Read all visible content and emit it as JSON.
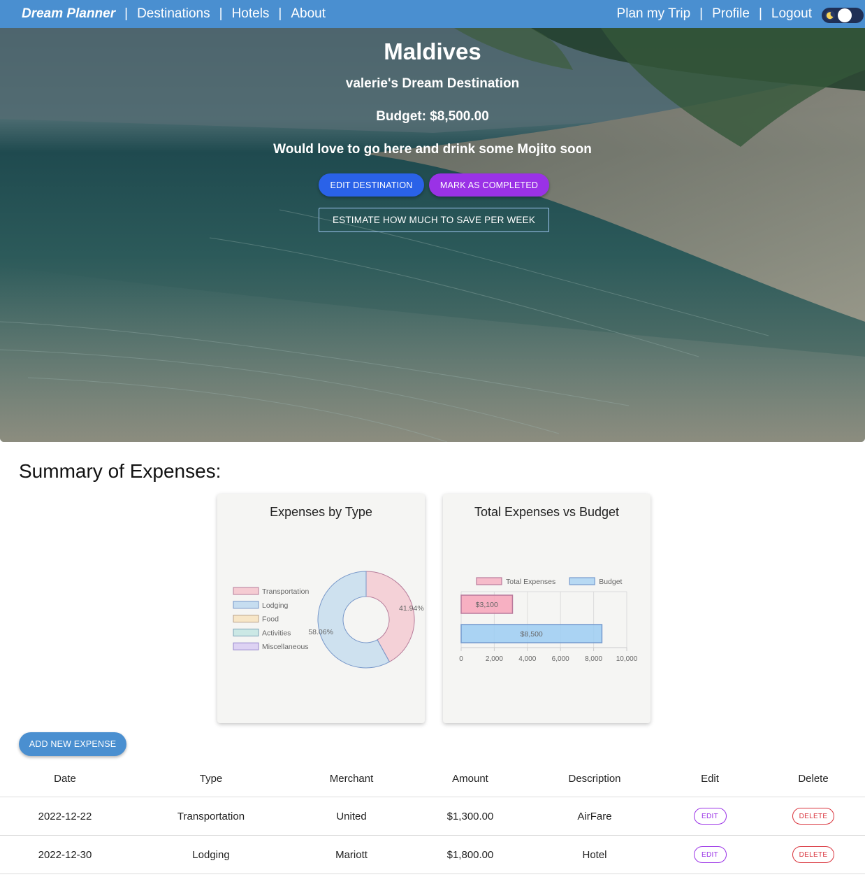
{
  "nav": {
    "brand": "Dream Planner",
    "links_left": [
      "Destinations",
      "Hotels",
      "About"
    ],
    "links_right": [
      "Plan my Trip",
      "Profile",
      "Logout"
    ],
    "separator": "|",
    "theme_toggle_icon": "moon-icon"
  },
  "hero": {
    "title": "Maldives",
    "subtitle": "valerie's Dream Destination",
    "budget": "Budget: $8,500.00",
    "note": "Would love to go here and drink some Mojito soon",
    "buttons": {
      "edit": "EDIT DESTINATION",
      "complete": "MARK AS COMPLETED",
      "estimate": "ESTIMATE HOW MUCH TO SAVE PER WEEK"
    },
    "colors": {
      "edit": "#2a62e8",
      "complete": "#9a32e6"
    }
  },
  "summary": {
    "title": "Summary of Expenses:"
  },
  "chart_data": [
    {
      "type": "pie",
      "title": "Expenses by Type",
      "labels": [
        "Transportation",
        "Lodging",
        "Food",
        "Activities",
        "Miscellaneous"
      ],
      "values": [
        41.94,
        58.06,
        0,
        0,
        0
      ],
      "value_labels": [
        "41.94%",
        "58.06%"
      ],
      "legend": "left",
      "colors": [
        "#f4a7b6",
        "#9fc9ec",
        "#f7d8a3",
        "#a8dcd8",
        "#c9b5f2"
      ]
    },
    {
      "type": "bar",
      "orientation": "horizontal",
      "title": "Total Expenses vs Budget",
      "series": [
        {
          "name": "Total Expenses",
          "value": 3100,
          "label": "$3,100"
        },
        {
          "name": "Budget",
          "value": 8500,
          "label": "$8,500"
        }
      ],
      "xlim": [
        0,
        10000
      ],
      "xticks": [
        "0",
        "2,000",
        "4,000",
        "6,000",
        "8,000",
        "10,000"
      ],
      "legend": "top",
      "grid": true,
      "colors": [
        "#f7a3b8",
        "#9ccdf2"
      ]
    }
  ],
  "table": {
    "add_button": "ADD NEW EXPENSE",
    "headers": [
      "Date",
      "Type",
      "Merchant",
      "Amount",
      "Description",
      "Edit",
      "Delete"
    ],
    "rows": [
      {
        "date": "2022-12-22",
        "type": "Transportation",
        "merchant": "United",
        "amount": "$1,300.00",
        "description": "AirFare",
        "edit": "EDIT",
        "delete": "DELETE"
      },
      {
        "date": "2022-12-30",
        "type": "Lodging",
        "merchant": "Mariott",
        "amount": "$1,800.00",
        "description": "Hotel",
        "edit": "EDIT",
        "delete": "DELETE"
      }
    ]
  }
}
